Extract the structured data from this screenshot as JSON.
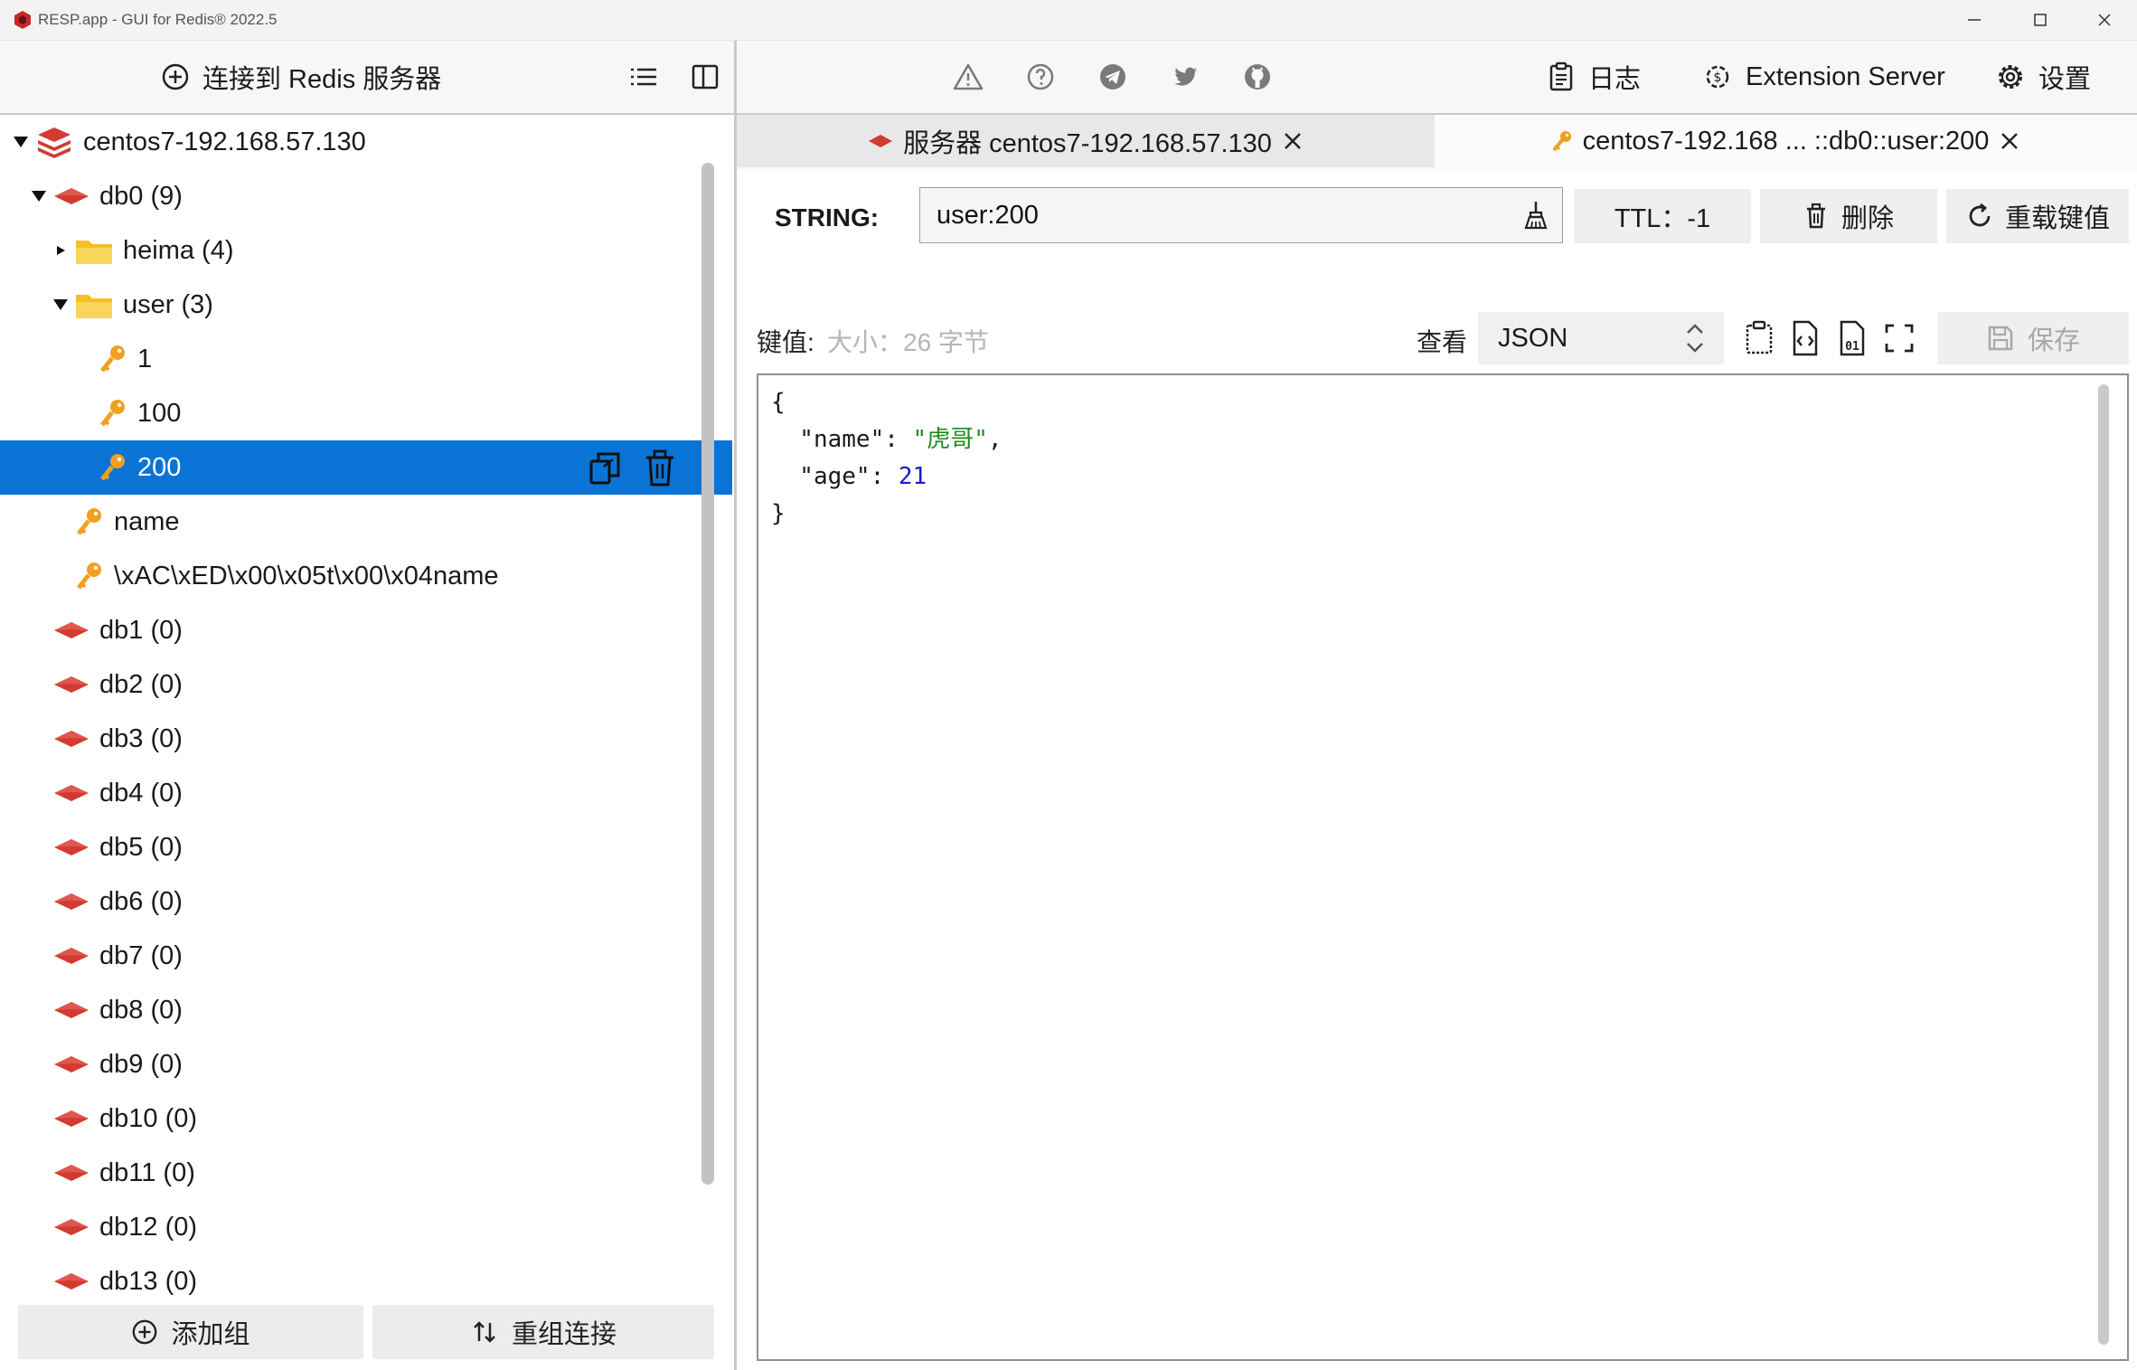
{
  "window": {
    "title": "RESP.app - GUI for Redis® 2022.5"
  },
  "left_panel": {
    "connect_label": "连接到 Redis 服务器",
    "tree": [
      {
        "depth": 0,
        "arrow": "down",
        "icon": "redis-server-icon",
        "label": "centos7-192.168.57.130"
      },
      {
        "depth": 1,
        "arrow": "down",
        "icon": "database-icon",
        "label": "db0  (9)"
      },
      {
        "depth": 2,
        "arrow": "right",
        "icon": "folder-icon",
        "label": "heima (4)"
      },
      {
        "depth": 2,
        "arrow": "down",
        "icon": "folder-icon",
        "label": "user (3)"
      },
      {
        "depth": 3,
        "arrow": "none",
        "icon": "key-icon",
        "label": "1"
      },
      {
        "depth": 3,
        "arrow": "none",
        "icon": "key-icon",
        "label": "100"
      },
      {
        "depth": 3,
        "arrow": "none",
        "icon": "key-icon",
        "label": "200",
        "selected": true
      },
      {
        "depth": 2,
        "arrow": "none",
        "icon": "key-icon",
        "label": "name"
      },
      {
        "depth": 2,
        "arrow": "none",
        "icon": "key-icon",
        "label": "\\xAC\\xED\\x00\\x05t\\x00\\x04name"
      },
      {
        "depth": 1,
        "arrow": "none",
        "icon": "database-icon",
        "label": "db1  (0)"
      },
      {
        "depth": 1,
        "arrow": "none",
        "icon": "database-icon",
        "label": "db2  (0)"
      },
      {
        "depth": 1,
        "arrow": "none",
        "icon": "database-icon",
        "label": "db3  (0)"
      },
      {
        "depth": 1,
        "arrow": "none",
        "icon": "database-icon",
        "label": "db4  (0)"
      },
      {
        "depth": 1,
        "arrow": "none",
        "icon": "database-icon",
        "label": "db5  (0)"
      },
      {
        "depth": 1,
        "arrow": "none",
        "icon": "database-icon",
        "label": "db6  (0)"
      },
      {
        "depth": 1,
        "arrow": "none",
        "icon": "database-icon",
        "label": "db7  (0)"
      },
      {
        "depth": 1,
        "arrow": "none",
        "icon": "database-icon",
        "label": "db8  (0)"
      },
      {
        "depth": 1,
        "arrow": "none",
        "icon": "database-icon",
        "label": "db9  (0)"
      },
      {
        "depth": 1,
        "arrow": "none",
        "icon": "database-icon",
        "label": "db10  (0)"
      },
      {
        "depth": 1,
        "arrow": "none",
        "icon": "database-icon",
        "label": "db11  (0)"
      },
      {
        "depth": 1,
        "arrow": "none",
        "icon": "database-icon",
        "label": "db12  (0)"
      },
      {
        "depth": 1,
        "arrow": "none",
        "icon": "database-icon",
        "label": "db13  (0)"
      }
    ],
    "add_group_label": "添加组",
    "reorder_label": "重组连接"
  },
  "right_panel": {
    "log_label": "日志",
    "extension_label": "Extension Server",
    "settings_label": "设置",
    "tabs": [
      {
        "label": "服务器 centos7-192.168.57.130"
      },
      {
        "label": "centos7-192.168 ... ::db0::user:200"
      }
    ],
    "key": {
      "type": "STRING:",
      "name": "user:200",
      "ttl": "TTL：-1",
      "delete_label": "删除",
      "reload_label": "重载键值"
    },
    "value": {
      "label": "键值:",
      "size": "大小：26 字节",
      "view_label": "查看",
      "format": "JSON",
      "save_label": "保存",
      "json": {
        "open": "{",
        "name_key": "  \"name\": ",
        "name_val": "\"虎哥\"",
        "comma": ",",
        "age_key": "  \"age\": ",
        "age_val": "21",
        "close": "}"
      }
    }
  },
  "colors": {
    "selection": "#0a74d6",
    "redis_red": "#d33a31",
    "key_orange": "#f0a020",
    "folder_yellow": "#f5c023"
  }
}
